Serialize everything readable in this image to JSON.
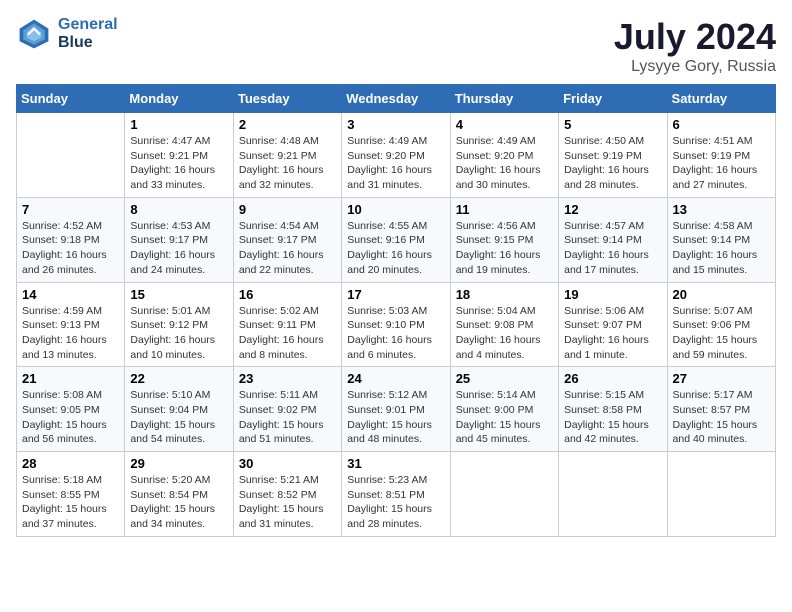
{
  "header": {
    "logo_line1": "General",
    "logo_line2": "Blue",
    "title": "July 2024",
    "subtitle": "Lysyye Gory, Russia"
  },
  "weekdays": [
    "Sunday",
    "Monday",
    "Tuesday",
    "Wednesday",
    "Thursday",
    "Friday",
    "Saturday"
  ],
  "weeks": [
    [
      {
        "day": "",
        "sunrise": "",
        "sunset": "",
        "daylight": ""
      },
      {
        "day": "1",
        "sunrise": "Sunrise: 4:47 AM",
        "sunset": "Sunset: 9:21 PM",
        "daylight": "Daylight: 16 hours and 33 minutes."
      },
      {
        "day": "2",
        "sunrise": "Sunrise: 4:48 AM",
        "sunset": "Sunset: 9:21 PM",
        "daylight": "Daylight: 16 hours and 32 minutes."
      },
      {
        "day": "3",
        "sunrise": "Sunrise: 4:49 AM",
        "sunset": "Sunset: 9:20 PM",
        "daylight": "Daylight: 16 hours and 31 minutes."
      },
      {
        "day": "4",
        "sunrise": "Sunrise: 4:49 AM",
        "sunset": "Sunset: 9:20 PM",
        "daylight": "Daylight: 16 hours and 30 minutes."
      },
      {
        "day": "5",
        "sunrise": "Sunrise: 4:50 AM",
        "sunset": "Sunset: 9:19 PM",
        "daylight": "Daylight: 16 hours and 28 minutes."
      },
      {
        "day": "6",
        "sunrise": "Sunrise: 4:51 AM",
        "sunset": "Sunset: 9:19 PM",
        "daylight": "Daylight: 16 hours and 27 minutes."
      }
    ],
    [
      {
        "day": "7",
        "sunrise": "Sunrise: 4:52 AM",
        "sunset": "Sunset: 9:18 PM",
        "daylight": "Daylight: 16 hours and 26 minutes."
      },
      {
        "day": "8",
        "sunrise": "Sunrise: 4:53 AM",
        "sunset": "Sunset: 9:17 PM",
        "daylight": "Daylight: 16 hours and 24 minutes."
      },
      {
        "day": "9",
        "sunrise": "Sunrise: 4:54 AM",
        "sunset": "Sunset: 9:17 PM",
        "daylight": "Daylight: 16 hours and 22 minutes."
      },
      {
        "day": "10",
        "sunrise": "Sunrise: 4:55 AM",
        "sunset": "Sunset: 9:16 PM",
        "daylight": "Daylight: 16 hours and 20 minutes."
      },
      {
        "day": "11",
        "sunrise": "Sunrise: 4:56 AM",
        "sunset": "Sunset: 9:15 PM",
        "daylight": "Daylight: 16 hours and 19 minutes."
      },
      {
        "day": "12",
        "sunrise": "Sunrise: 4:57 AM",
        "sunset": "Sunset: 9:14 PM",
        "daylight": "Daylight: 16 hours and 17 minutes."
      },
      {
        "day": "13",
        "sunrise": "Sunrise: 4:58 AM",
        "sunset": "Sunset: 9:14 PM",
        "daylight": "Daylight: 16 hours and 15 minutes."
      }
    ],
    [
      {
        "day": "14",
        "sunrise": "Sunrise: 4:59 AM",
        "sunset": "Sunset: 9:13 PM",
        "daylight": "Daylight: 16 hours and 13 minutes."
      },
      {
        "day": "15",
        "sunrise": "Sunrise: 5:01 AM",
        "sunset": "Sunset: 9:12 PM",
        "daylight": "Daylight: 16 hours and 10 minutes."
      },
      {
        "day": "16",
        "sunrise": "Sunrise: 5:02 AM",
        "sunset": "Sunset: 9:11 PM",
        "daylight": "Daylight: 16 hours and 8 minutes."
      },
      {
        "day": "17",
        "sunrise": "Sunrise: 5:03 AM",
        "sunset": "Sunset: 9:10 PM",
        "daylight": "Daylight: 16 hours and 6 minutes."
      },
      {
        "day": "18",
        "sunrise": "Sunrise: 5:04 AM",
        "sunset": "Sunset: 9:08 PM",
        "daylight": "Daylight: 16 hours and 4 minutes."
      },
      {
        "day": "19",
        "sunrise": "Sunrise: 5:06 AM",
        "sunset": "Sunset: 9:07 PM",
        "daylight": "Daylight: 16 hours and 1 minute."
      },
      {
        "day": "20",
        "sunrise": "Sunrise: 5:07 AM",
        "sunset": "Sunset: 9:06 PM",
        "daylight": "Daylight: 15 hours and 59 minutes."
      }
    ],
    [
      {
        "day": "21",
        "sunrise": "Sunrise: 5:08 AM",
        "sunset": "Sunset: 9:05 PM",
        "daylight": "Daylight: 15 hours and 56 minutes."
      },
      {
        "day": "22",
        "sunrise": "Sunrise: 5:10 AM",
        "sunset": "Sunset: 9:04 PM",
        "daylight": "Daylight: 15 hours and 54 minutes."
      },
      {
        "day": "23",
        "sunrise": "Sunrise: 5:11 AM",
        "sunset": "Sunset: 9:02 PM",
        "daylight": "Daylight: 15 hours and 51 minutes."
      },
      {
        "day": "24",
        "sunrise": "Sunrise: 5:12 AM",
        "sunset": "Sunset: 9:01 PM",
        "daylight": "Daylight: 15 hours and 48 minutes."
      },
      {
        "day": "25",
        "sunrise": "Sunrise: 5:14 AM",
        "sunset": "Sunset: 9:00 PM",
        "daylight": "Daylight: 15 hours and 45 minutes."
      },
      {
        "day": "26",
        "sunrise": "Sunrise: 5:15 AM",
        "sunset": "Sunset: 8:58 PM",
        "daylight": "Daylight: 15 hours and 42 minutes."
      },
      {
        "day": "27",
        "sunrise": "Sunrise: 5:17 AM",
        "sunset": "Sunset: 8:57 PM",
        "daylight": "Daylight: 15 hours and 40 minutes."
      }
    ],
    [
      {
        "day": "28",
        "sunrise": "Sunrise: 5:18 AM",
        "sunset": "Sunset: 8:55 PM",
        "daylight": "Daylight: 15 hours and 37 minutes."
      },
      {
        "day": "29",
        "sunrise": "Sunrise: 5:20 AM",
        "sunset": "Sunset: 8:54 PM",
        "daylight": "Daylight: 15 hours and 34 minutes."
      },
      {
        "day": "30",
        "sunrise": "Sunrise: 5:21 AM",
        "sunset": "Sunset: 8:52 PM",
        "daylight": "Daylight: 15 hours and 31 minutes."
      },
      {
        "day": "31",
        "sunrise": "Sunrise: 5:23 AM",
        "sunset": "Sunset: 8:51 PM",
        "daylight": "Daylight: 15 hours and 28 minutes."
      },
      {
        "day": "",
        "sunrise": "",
        "sunset": "",
        "daylight": ""
      },
      {
        "day": "",
        "sunrise": "",
        "sunset": "",
        "daylight": ""
      },
      {
        "day": "",
        "sunrise": "",
        "sunset": "",
        "daylight": ""
      }
    ]
  ]
}
